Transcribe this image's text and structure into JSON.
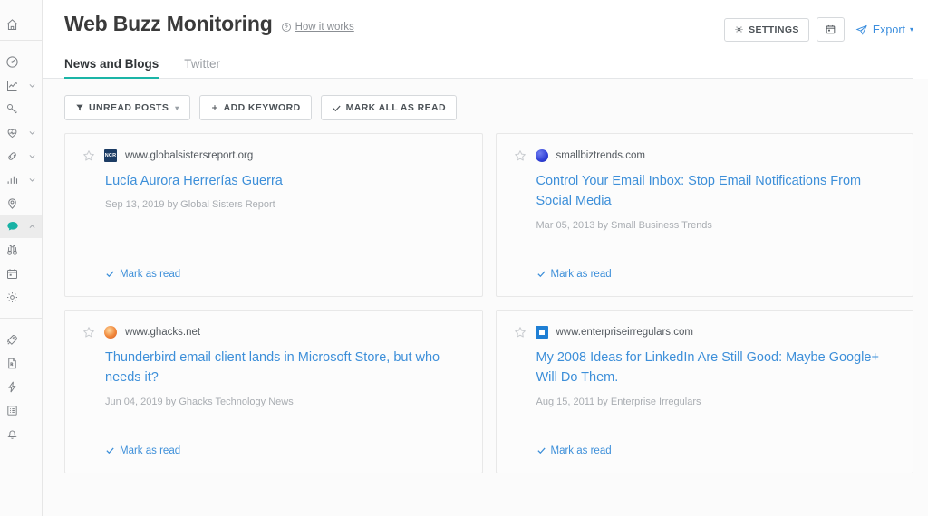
{
  "sidebar": {
    "groups": [
      {
        "items": [
          {
            "icon": "home-icon",
            "name": "home",
            "chevron": false
          }
        ]
      },
      {
        "items": [
          {
            "icon": "dashboard-gauge-icon",
            "name": "dashboard",
            "chevron": false
          },
          {
            "icon": "analytics-chart-icon",
            "name": "analytics",
            "chevron": true
          },
          {
            "icon": "key-icon",
            "name": "keywords",
            "chevron": false
          },
          {
            "icon": "site-health-icon",
            "name": "site-health",
            "chevron": true
          },
          {
            "icon": "backlinks-chain-icon",
            "name": "backlinks",
            "chevron": true
          },
          {
            "icon": "bar-chart-icon",
            "name": "rank-tracking",
            "chevron": true
          },
          {
            "icon": "map-pin-icon",
            "name": "local-seo",
            "chevron": false
          },
          {
            "icon": "chat-bubble-icon",
            "name": "web-buzz-monitoring",
            "chevron": true,
            "active": true
          },
          {
            "icon": "binoculars-icon",
            "name": "competitor-research",
            "chevron": false
          },
          {
            "icon": "calendar-icon",
            "name": "calendar",
            "chevron": false
          },
          {
            "icon": "gear-icon",
            "name": "settings",
            "chevron": false
          }
        ]
      },
      {
        "items": [
          {
            "icon": "rocket-icon",
            "name": "boost",
            "chevron": false
          },
          {
            "icon": "pdf-document-icon",
            "name": "reports",
            "chevron": false
          },
          {
            "icon": "lightning-bolt-icon",
            "name": "quick-actions",
            "chevron": false
          },
          {
            "icon": "list-checklist-icon",
            "name": "tasks",
            "chevron": false
          },
          {
            "icon": "bell-icon",
            "name": "notifications",
            "chevron": false
          }
        ]
      }
    ]
  },
  "header": {
    "title": "Web Buzz Monitoring",
    "how_it_works": "How it works",
    "help_icon": "question-circle-icon",
    "settings_label": "SETTINGS",
    "settings_icon": "gear-icon",
    "calendar_icon": "calendar-icon",
    "export_label": "Export",
    "export_icon": "paper-plane-icon",
    "export_caret": "▾"
  },
  "tabs": [
    {
      "label": "News and Blogs",
      "active": true
    },
    {
      "label": "Twitter",
      "active": false
    }
  ],
  "toolbar": {
    "unread_label": "UNREAD POSTS",
    "unread_icon": "filter-funnel-icon",
    "unread_caret": "▾",
    "add_keyword_label": "ADD KEYWORD",
    "add_keyword_icon": "plus-icon",
    "mark_all_label": "MARK ALL AS READ",
    "mark_all_icon": "check-icon"
  },
  "colors": {
    "accent_teal": "#1bb5a7",
    "link_blue": "#3d8fd9",
    "export_blue": "#3b8ede"
  },
  "cards": [
    {
      "domain": "www.globalsistersreport.org",
      "favicon": "ncr-badge",
      "favicon_text": "NCR",
      "title": "Lucía Aurora Herrerías Guerra",
      "meta": "Sep 13, 2019 by Global Sisters Report",
      "action": "Mark as read",
      "star_icon": "star-outline-icon"
    },
    {
      "domain": "smallbiztrends.com",
      "favicon": "blue-sphere",
      "favicon_text": "",
      "title": "Control Your Email Inbox: Stop Email Notifications From Social Media",
      "meta": "Mar 05, 2013 by Small Business Trends",
      "action": "Mark as read",
      "star_icon": "star-outline-icon"
    },
    {
      "domain": "www.ghacks.net",
      "favicon": "orange-sphere",
      "favicon_text": "",
      "title": "Thunderbird email client lands in Microsoft Store, but who needs it?",
      "meta": "Jun 04, 2019 by Ghacks Technology News",
      "action": "Mark as read",
      "star_icon": "star-outline-icon"
    },
    {
      "domain": "www.enterpriseirregulars.com",
      "favicon": "blue-square",
      "favicon_text": "",
      "title": "My 2008 Ideas for LinkedIn Are Still Good: Maybe Google+ Will Do Them.",
      "meta": "Aug 15, 2011 by Enterprise Irregulars",
      "action": "Mark as read",
      "star_icon": "star-outline-icon"
    }
  ]
}
